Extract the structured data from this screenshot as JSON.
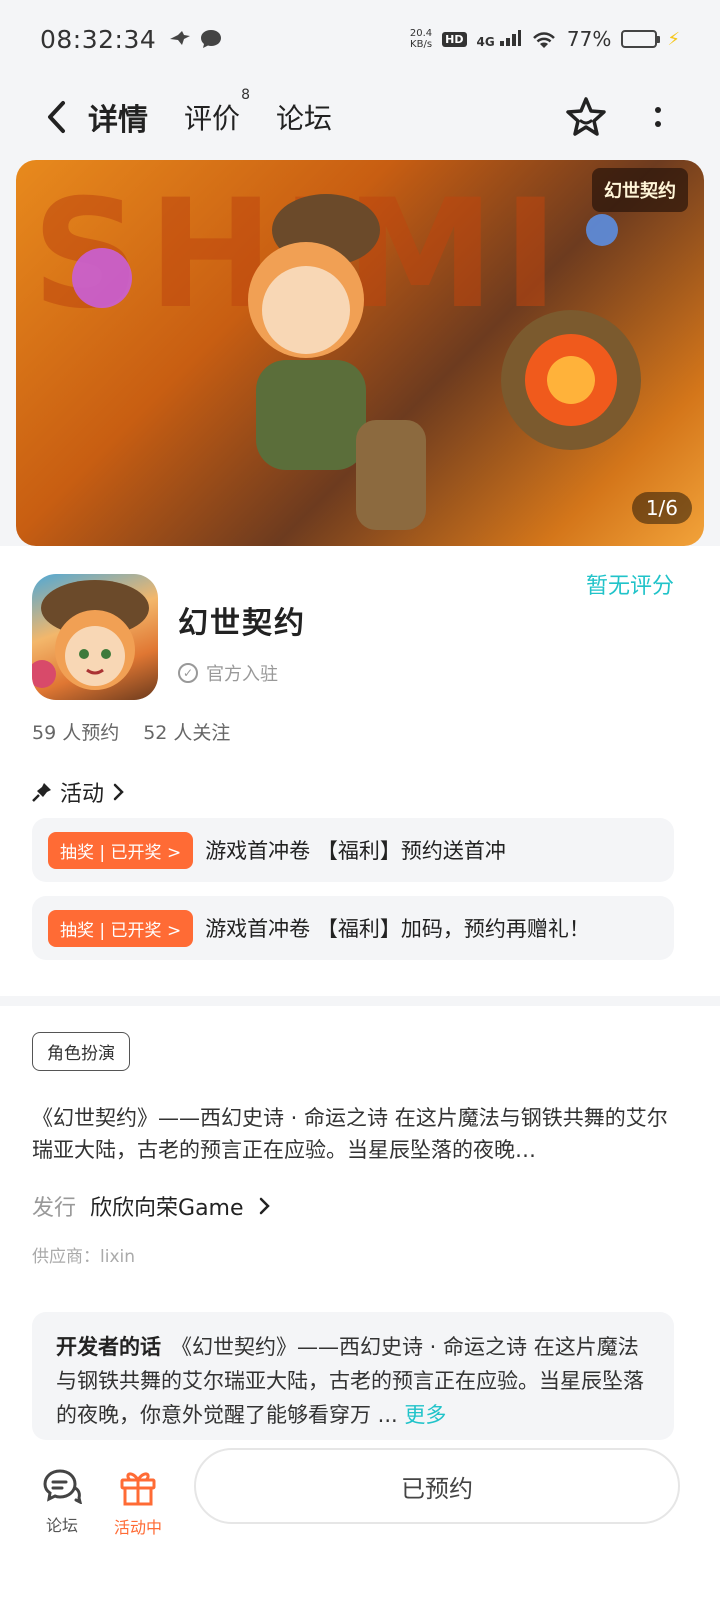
{
  "status_bar": {
    "time": "08:32:34",
    "speed_value": "20.4",
    "speed_unit": "KB/s",
    "hd": "HD",
    "network": "4G",
    "battery": "77%",
    "battery_level": 0.77
  },
  "header": {
    "tabs": [
      {
        "label": "详情",
        "active": true
      },
      {
        "label": "评价",
        "badge": "8"
      },
      {
        "label": "论坛"
      }
    ],
    "icons": [
      "back-arrow-icon",
      "favorite-star-icon",
      "more-icon"
    ]
  },
  "banner": {
    "counter": "1/6",
    "logo_text": "幻世契约",
    "bg_text": "SHIMI"
  },
  "game": {
    "name": "幻世契约",
    "official": "官方入驻",
    "rating": "暂无评分",
    "reservations": "59 人预约",
    "followers": "52 人关注"
  },
  "activities": {
    "title": "活动",
    "items": [
      {
        "badge": "抽奖 | 已开奖 >",
        "text": "游戏首冲卷 【福利】预约送首冲"
      },
      {
        "badge": "抽奖 | 已开奖 >",
        "text": "游戏首冲卷 【福利】加码，预约再赠礼！"
      }
    ]
  },
  "detail": {
    "tag": "角色扮演",
    "description": "《幻世契约》——西幻史诗 · 命运之诗 在这片魔法与钢铁共舞的艾尔瑞亚大陆，古老的预言正在应验。当星辰坠落的夜晚…",
    "publisher_label": "发行",
    "publisher": "欣欣向荣Game",
    "supplier": "供应商：lixin",
    "dev_label": "开发者的话",
    "dev_text": "《幻世契约》——西幻史诗 · 命运之诗 在这片魔法与钢铁共舞的艾尔瑞亚大陆，古老的预言正在应验。当星辰坠落的夜晚，你意外觉醒了能够看穿万 ...",
    "more": "更多"
  },
  "bottom_bar": {
    "forum": "论坛",
    "activity": "活动中",
    "reserve_button": "已预约"
  },
  "colors": {
    "accent": "#21c3c9",
    "orange": "#ff6b35",
    "page_bg": "#f4f5f7"
  }
}
